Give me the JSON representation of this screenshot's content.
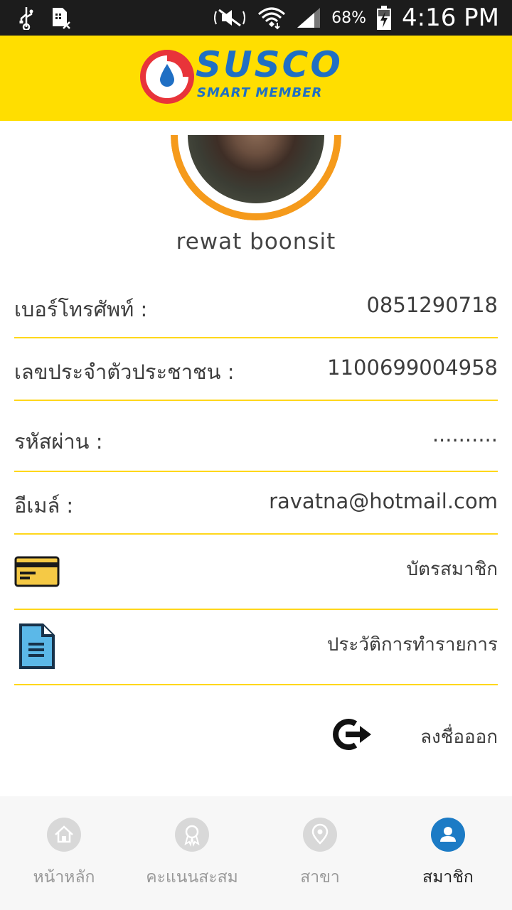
{
  "status_bar": {
    "battery_percent": "68%",
    "time": "4:16 PM"
  },
  "header": {
    "logo_main": "SUSCO",
    "logo_sub": "SMART MEMBER"
  },
  "profile": {
    "name": "rewat boonsit"
  },
  "fields": [
    {
      "label": "เบอร์โทรศัพท์ :",
      "value": "0851290718"
    },
    {
      "label": "เลขประจำตัวประชาชน :",
      "value": "1100699004958"
    },
    {
      "label": "รหัสผ่าน :",
      "value": ".........."
    },
    {
      "label": "อีเมล์ :",
      "value": "ravatna@hotmail.com"
    }
  ],
  "actions": {
    "member_card": "บัตรสมาชิก",
    "transaction_history": "ประวัติการทำรายการ",
    "logout": "ลงชื่อออก"
  },
  "bottom_nav": [
    {
      "label": "หน้าหลัก",
      "icon": "home-icon",
      "active": false
    },
    {
      "label": "คะแนนสะสม",
      "icon": "award-icon",
      "active": false
    },
    {
      "label": "สาขา",
      "icon": "location-pin-icon",
      "active": false
    },
    {
      "label": "สมาชิก",
      "icon": "user-icon",
      "active": true
    }
  ],
  "colors": {
    "header_bg": "#ffde00",
    "divider": "#ffd71b",
    "avatar_ring": "#f59a1b",
    "active_nav": "#1c7bc5",
    "logo_blue": "#1f6fc4",
    "logo_red": "#e8343a"
  }
}
